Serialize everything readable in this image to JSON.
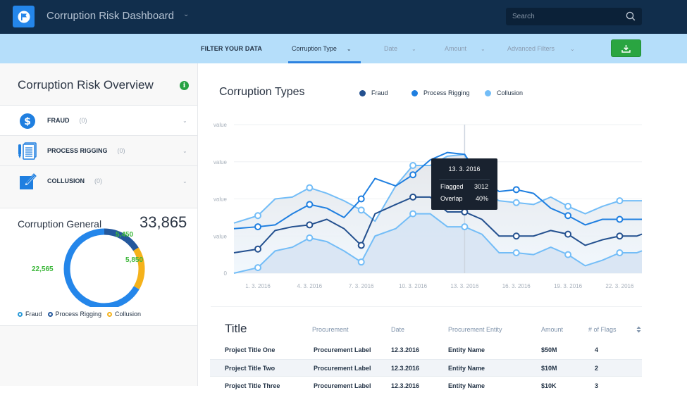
{
  "header": {
    "app_title": "Corruption Risk Dashboard",
    "search_placeholder": "Search"
  },
  "filters": {
    "label": "FILTER YOUR DATA",
    "items": [
      {
        "label": "Corruption Type",
        "active": true
      },
      {
        "label": "Date",
        "active": false
      },
      {
        "label": "Amount",
        "active": false
      },
      {
        "label": "Advanced Filters",
        "active": false
      }
    ],
    "download_icon": "download-icon"
  },
  "sidebar": {
    "title": "Corruption Risk Overview",
    "info_icon": "i",
    "categories": [
      {
        "label": "FRAUD",
        "count": "(0)",
        "icon": "dollar-icon"
      },
      {
        "label": "PROCESS RIGGING",
        "count": "(0)",
        "icon": "documents-pen-icon"
      },
      {
        "label": "COLLUSION",
        "count": "(0)",
        "icon": "edit-pen-icon"
      }
    ],
    "general": {
      "title": "Corruption General",
      "total": "33,865",
      "segments": [
        {
          "name": "Fraud",
          "value": 22565,
          "label": "22,565",
          "color": "#2486ea"
        },
        {
          "name": "Process Rigging",
          "value": 5450,
          "label": "5,450",
          "color": "#24589c"
        },
        {
          "name": "Collusion",
          "value": 5850,
          "label": "5,850",
          "color": "#f5b21b"
        }
      ],
      "legend": [
        {
          "name": "Fraud",
          "color": "#2a9ad8"
        },
        {
          "name": "Process Rigging",
          "color": "#24589c"
        },
        {
          "name": "Collusion",
          "color": "#f5b21b"
        }
      ]
    }
  },
  "chart_data": {
    "type": "line",
    "title": "Corruption Types",
    "legend": [
      {
        "name": "Fraud",
        "color": "#23508f"
      },
      {
        "name": "Process Rigging",
        "color": "#1f7fe0"
      },
      {
        "name": "Collusion",
        "color": "#73bdf7"
      }
    ],
    "y_tick_labels": [
      "0",
      "value",
      "value",
      "value",
      "value"
    ],
    "ylim": [
      0,
      4
    ],
    "x_tick_labels": [
      "1. 3. 2016",
      "4. 3. 2016",
      "7. 3. 2016",
      "10. 3. 2016",
      "13. 3. 2016",
      "16. 3. 2016",
      "19. 3. 2016",
      "22. 3. 2016"
    ],
    "x_tick_days": [
      1,
      4,
      7,
      10,
      13,
      16,
      19,
      22
    ],
    "x_days": [
      -0.4,
      1,
      2,
      3,
      4,
      5,
      6,
      7,
      7.8,
      9,
      10,
      11,
      12,
      13,
      14,
      15,
      16,
      17,
      18,
      19,
      20,
      21,
      22,
      23,
      23.3
    ],
    "series": [
      {
        "name": "Collusion",
        "role": "upper",
        "color": "#73bdf7",
        "values": [
          1.35,
          1.55,
          2.0,
          2.05,
          2.3,
          2.15,
          1.95,
          1.7,
          1.4,
          2.35,
          2.9,
          2.9,
          3.15,
          3.2,
          2.2,
          1.95,
          1.9,
          1.85,
          2.05,
          1.8,
          1.6,
          1.8,
          1.95,
          1.95,
          1.95
        ],
        "markers": [
          1,
          4,
          7,
          10,
          16,
          19,
          22
        ]
      },
      {
        "name": "Process Rigging",
        "role": "main",
        "color": "#1f7fe0",
        "values": [
          1.2,
          1.25,
          1.3,
          1.6,
          1.85,
          1.75,
          1.5,
          2.0,
          2.55,
          2.35,
          2.65,
          3.05,
          3.25,
          3.2,
          2.5,
          2.2,
          2.25,
          2.15,
          1.75,
          1.55,
          1.3,
          1.45,
          1.45,
          1.45,
          1.45
        ],
        "markers": [
          1,
          4,
          7,
          10,
          16,
          19,
          22
        ]
      },
      {
        "name": "Fraud",
        "role": "main",
        "color": "#23508f",
        "values": [
          0.55,
          0.65,
          1.15,
          1.25,
          1.3,
          1.45,
          1.2,
          0.75,
          1.6,
          1.85,
          2.05,
          2.05,
          1.65,
          1.65,
          1.45,
          1.0,
          1.0,
          1.0,
          1.15,
          1.05,
          0.75,
          0.9,
          1.0,
          1.0,
          1.05
        ],
        "markers": [
          1,
          4,
          7,
          10,
          13,
          16,
          19,
          22
        ]
      },
      {
        "name": "Collusion",
        "role": "lower",
        "color": "#73bdf7",
        "values": [
          0.0,
          0.15,
          0.6,
          0.7,
          0.95,
          0.85,
          0.6,
          0.3,
          1.0,
          1.2,
          1.6,
          1.6,
          1.25,
          1.25,
          1.05,
          0.55,
          0.55,
          0.5,
          0.7,
          0.5,
          0.2,
          0.35,
          0.55,
          0.55,
          0.6
        ],
        "markers": [
          1,
          4,
          7,
          10,
          13,
          16,
          19,
          22
        ]
      }
    ],
    "crosshair_day": 13,
    "tooltip": {
      "date": "13. 3. 2016",
      "rows": [
        {
          "label": "Flagged",
          "value": "3012"
        },
        {
          "label": "Overlap",
          "value": "40%"
        }
      ]
    }
  },
  "table": {
    "title": "Title",
    "columns": [
      "Procurement",
      "Date",
      "Procurement Entity",
      "Amount",
      "# of Flags"
    ],
    "rows": [
      {
        "title": "Project Title One",
        "procurement": "Procurement Label",
        "date": "12.3.2016",
        "entity": "Entity Name",
        "amount": "$50M",
        "flags": "4"
      },
      {
        "title": "Project Title Two",
        "procurement": "Procurement Label",
        "date": "12.3.2016",
        "entity": "Entity Name",
        "amount": "$10M",
        "flags": "2"
      },
      {
        "title": "Project Title Three",
        "procurement": "Procurement Label",
        "date": "12.3.2016",
        "entity": "Entity Name",
        "amount": "$10K",
        "flags": "3"
      }
    ]
  }
}
